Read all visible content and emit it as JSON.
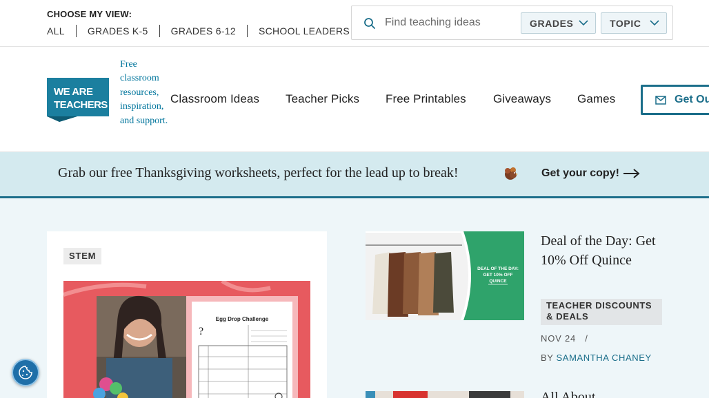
{
  "view_switcher": {
    "title": "CHOOSE MY VIEW:",
    "options": [
      "ALL",
      "GRADES K-5",
      "GRADES 6-12",
      "SCHOOL LEADERS"
    ]
  },
  "search": {
    "placeholder": "Find teaching ideas",
    "grades_label": "GRADES",
    "topic_label": "TOPIC"
  },
  "brand": {
    "logo_text_line1": "WE ARE",
    "logo_text_line2": "TEACHERS",
    "tagline": "Free classroom resources, inspiration, and support.",
    "color": "#1b7f9f"
  },
  "nav": {
    "items": [
      "Classroom Ideas",
      "Teacher Picks",
      "Free Printables",
      "Giveaways",
      "Games"
    ],
    "cta_label": "Get Ou"
  },
  "banner": {
    "text": "Grab our free Thanksgiving worksheets, perfect for the lead up to break!",
    "link_label": "Get your copy!",
    "icon": "turkey-icon"
  },
  "featured": {
    "tag": "STEM",
    "image_title": "Egg Drop Challenge"
  },
  "side_article": {
    "thumb_text": "DEAL OF THE DAY: GET 10% OFF QUINCE",
    "title": "Deal of the Day: Get 10% Off Quince",
    "category": "TEACHER DISCOUNTS & DEALS",
    "date": "NOV 24",
    "date_sep": "/",
    "by_label": "BY",
    "author": "SAMANTHA CHANEY"
  },
  "second_article": {
    "title": "All About"
  },
  "colors": {
    "accent": "#1b6e8a",
    "banner_bg": "#d4eaef",
    "content_bg": "#eef6f9",
    "deal_green": "#2fa36b"
  }
}
